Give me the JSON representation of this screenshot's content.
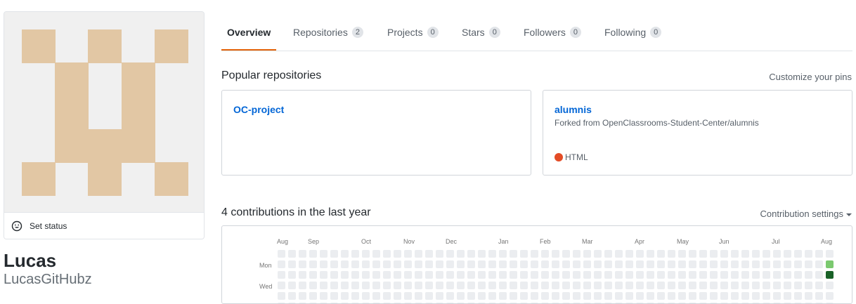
{
  "profile": {
    "name": "Lucas",
    "login": "LucasGitHubz",
    "status_label": "Set status",
    "avatar_color": "#e2c7a4"
  },
  "tabs": [
    {
      "label": "Overview",
      "count": null,
      "active": true
    },
    {
      "label": "Repositories",
      "count": "2",
      "active": false
    },
    {
      "label": "Projects",
      "count": "0",
      "active": false
    },
    {
      "label": "Stars",
      "count": "0",
      "active": false
    },
    {
      "label": "Followers",
      "count": "0",
      "active": false
    },
    {
      "label": "Following",
      "count": "0",
      "active": false
    }
  ],
  "popular": {
    "title": "Popular repositories",
    "customize_label": "Customize your pins",
    "repos": [
      {
        "name": "OC-project",
        "fork_text": "",
        "language": "",
        "lang_color": ""
      },
      {
        "name": "alumnis",
        "fork_text": "Forked from OpenClassrooms-Student-Center/alumnis",
        "language": "HTML",
        "lang_color": "#e34c26"
      }
    ]
  },
  "contributions": {
    "title": "4 contributions in the last year",
    "settings_label": "Contribution settings",
    "months": [
      "Aug",
      "Sep",
      "Oct",
      "Nov",
      "Dec",
      "Jan",
      "Feb",
      "Mar",
      "Apr",
      "May",
      "Jun",
      "Jul",
      "Aug"
    ],
    "weekdays": [
      "Mon",
      "Wed"
    ],
    "empty_color": "#ebedf0",
    "active_cells": [
      {
        "week": 52,
        "day": 1,
        "level_color": "#7bc96f"
      },
      {
        "week": 52,
        "day": 2,
        "level_color": "#196127"
      }
    ]
  }
}
